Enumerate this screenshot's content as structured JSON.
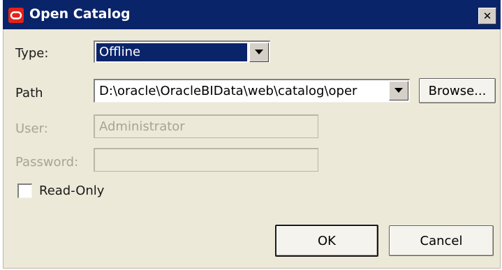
{
  "window": {
    "title": "Open Catalog",
    "close_glyph": "✕",
    "app_icon": "oracle-logo-icon"
  },
  "form": {
    "type": {
      "label": "Type:",
      "value": "Offline"
    },
    "path": {
      "label": "Path",
      "value": "D:\\oracle\\OracleBIData\\web\\catalog\\oper",
      "browse_label": "Browse..."
    },
    "user": {
      "label": "User:",
      "value": "Administrator"
    },
    "password": {
      "label": "Password:",
      "value": ""
    },
    "read_only": {
      "label": "Read-Only",
      "checked": false
    }
  },
  "buttons": {
    "ok": "OK",
    "cancel": "Cancel"
  },
  "colors": {
    "titlebar": "#0a246a",
    "dialog_bg": "#ece9d8",
    "selection": "#0a246a",
    "oracle_red": "#e2231a",
    "disabled_text": "#a7a496"
  }
}
